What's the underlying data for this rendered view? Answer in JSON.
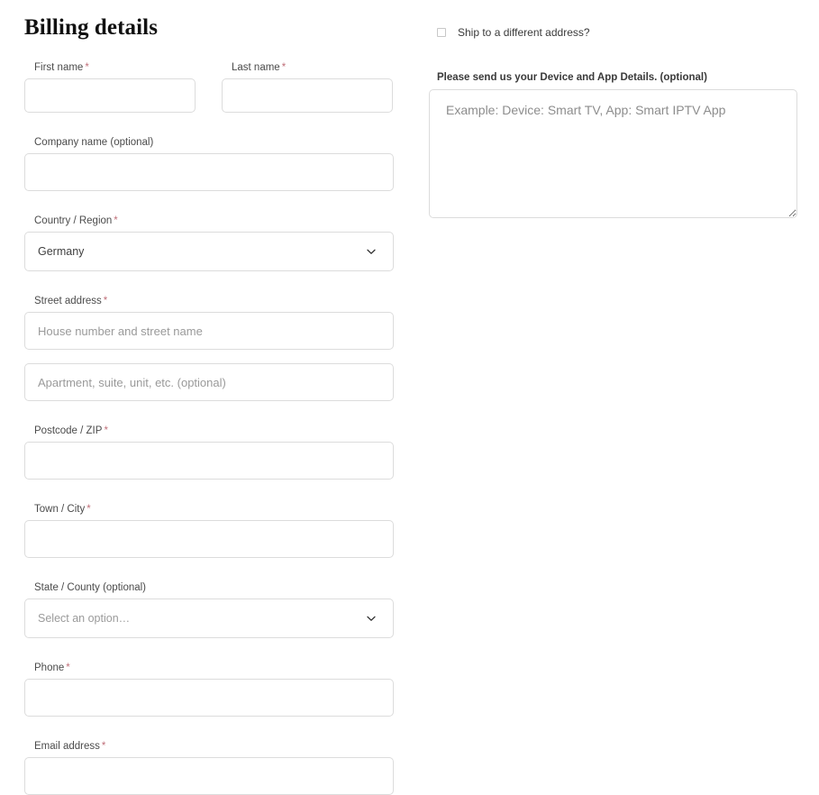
{
  "billing": {
    "title": "Billing details",
    "required_marker": "*",
    "fields": {
      "first_name": {
        "label": "First name",
        "required": true,
        "value": "",
        "placeholder": ""
      },
      "last_name": {
        "label": "Last name",
        "required": true,
        "value": "",
        "placeholder": ""
      },
      "company_name": {
        "label": "Company name (optional)",
        "required": false,
        "value": "",
        "placeholder": ""
      },
      "country": {
        "label": "Country / Region",
        "required": true,
        "value": "Germany",
        "icon": "chevron-down-icon"
      },
      "street_address": {
        "label": "Street address",
        "required": true,
        "value": "",
        "placeholder": "House number and street name"
      },
      "address_line_2": {
        "label": "",
        "required": false,
        "value": "",
        "placeholder": "Apartment, suite, unit, etc. (optional)"
      },
      "postcode": {
        "label": "Postcode / ZIP",
        "required": true,
        "value": "",
        "placeholder": ""
      },
      "town_city": {
        "label": "Town / City",
        "required": true,
        "value": "",
        "placeholder": ""
      },
      "state_county": {
        "label": "State / County (optional)",
        "required": false,
        "value": "Select an option…",
        "icon": "chevron-down-icon"
      },
      "phone": {
        "label": "Phone",
        "required": true,
        "value": "",
        "placeholder": ""
      },
      "email": {
        "label": "Email address",
        "required": true,
        "value": "",
        "placeholder": ""
      }
    }
  },
  "shipping": {
    "toggle_label": "Ship to a different address?",
    "checked": false,
    "checkbox_icon": "checkbox-unchecked-icon"
  },
  "additional": {
    "device_label": "Please send us your Device and App Details. (optional)",
    "device_value": "",
    "device_placeholder": "Example: Device: Smart TV, App: Smart IPTV App",
    "resize_handle_icon": "resize-grip-icon"
  },
  "colors": {
    "background": "#ffffff",
    "border": "#dcdcdc",
    "label_text": "#4b4b4b",
    "required_asterisk": "#c0707a",
    "placeholder_text": "#9a9a9a",
    "heading_text": "#111111"
  }
}
